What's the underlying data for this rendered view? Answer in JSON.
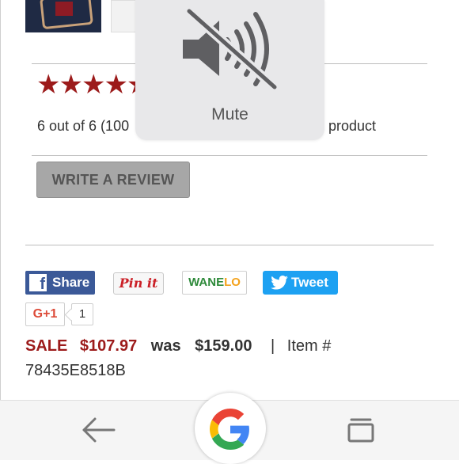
{
  "rating": {
    "stars": "★★★★★",
    "summary_start": "6 out of 6 (100",
    "summary_end": "product"
  },
  "write_review_label": "WRITE A REVIEW",
  "social": {
    "facebook_label": "Share",
    "facebook_glyph": "f",
    "pinterest_label": "Pin it",
    "wanelo_label_a": "WANE",
    "wanelo_label_b": "LO",
    "twitter_label": "Tweet",
    "gplus_label": "G+1",
    "gplus_count": "1"
  },
  "price": {
    "sale_label": "SALE",
    "sale_price": "$107.97",
    "was_label": "was",
    "was_price": "$159.00",
    "separator": "|",
    "item_label": "Item #",
    "item_number": "78435E8518B"
  },
  "mute_overlay": {
    "label": "Mute",
    "icon": "speaker-muted-icon"
  },
  "navbar": {
    "back_icon": "back-arrow-icon",
    "home_icon": "google-g-icon",
    "recent_icon": "recent-apps-icon"
  },
  "colors": {
    "brand_red": "#9c1b1b",
    "facebook": "#3b5998",
    "twitter": "#1da1f2",
    "gplus": "#dd4b39"
  }
}
